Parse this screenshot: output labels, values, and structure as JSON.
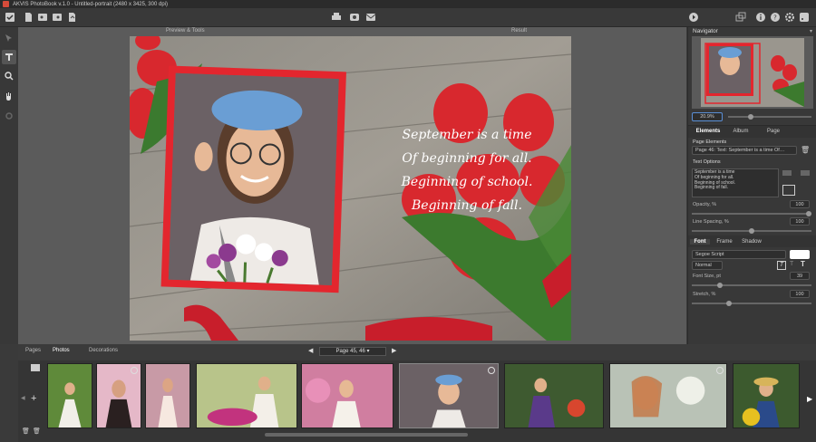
{
  "window": {
    "title": "AKVIS PhotoBook v.1.0 - Untitled-portrait (2480 x 3425, 300 dpi)"
  },
  "toolbar": {
    "left_icons": [
      "check-icon",
      "new-page-icon",
      "open-icon",
      "save-icon",
      "export-icon"
    ],
    "center_icons": [
      "print-icon",
      "preview-eye-icon",
      "share-icon"
    ],
    "right_icons": [
      "run-icon",
      "layers-icon",
      "info-icon",
      "help-icon",
      "settings-icon",
      "feed-icon"
    ]
  },
  "canvas": {
    "tab_preview": "Preview & Tools",
    "tab_result": "Result",
    "poem_lines": [
      "September is a time",
      "Of beginning for all.",
      "Beginning of school.",
      "Beginning of fall."
    ]
  },
  "navigator": {
    "title": "Navigator",
    "zoom": "20.9%"
  },
  "panel_tabs": {
    "elements": "Elements",
    "album": "Album",
    "page": "Page"
  },
  "page_elements": {
    "label": "Page Elements",
    "selected": "Page 46: Text: September is a time Of…"
  },
  "text_options": {
    "label": "Text Options",
    "text_lines": [
      "September is a time",
      "Of beginning for all.",
      "Beginning of school.",
      "Beginning of fall."
    ],
    "opacity_label": "Opacity, %",
    "opacity_value": "100",
    "opacity_frac": 1.0,
    "spacing_label": "Line Spacing, %",
    "spacing_value": "100",
    "spacing_frac": 0.5
  },
  "font_tabs": {
    "font": "Font",
    "frame": "Frame",
    "shadow": "Shadow"
  },
  "font": {
    "family": "Segoe Script",
    "style": "Normal",
    "size_label": "Font Size, pt",
    "size_value": "39",
    "size_frac": 0.22,
    "stretch_label": "Stretch, %",
    "stretch_value": "100",
    "stretch_frac": 0.3
  },
  "bottom": {
    "tab_pages": "Pages",
    "tab_photos": "Photos",
    "tab_decorations": "Decorations",
    "page_selector": "Page 45, 46"
  },
  "colors": {
    "frame_red": "#e3262e",
    "accent_blue": "#5a8fd6"
  }
}
